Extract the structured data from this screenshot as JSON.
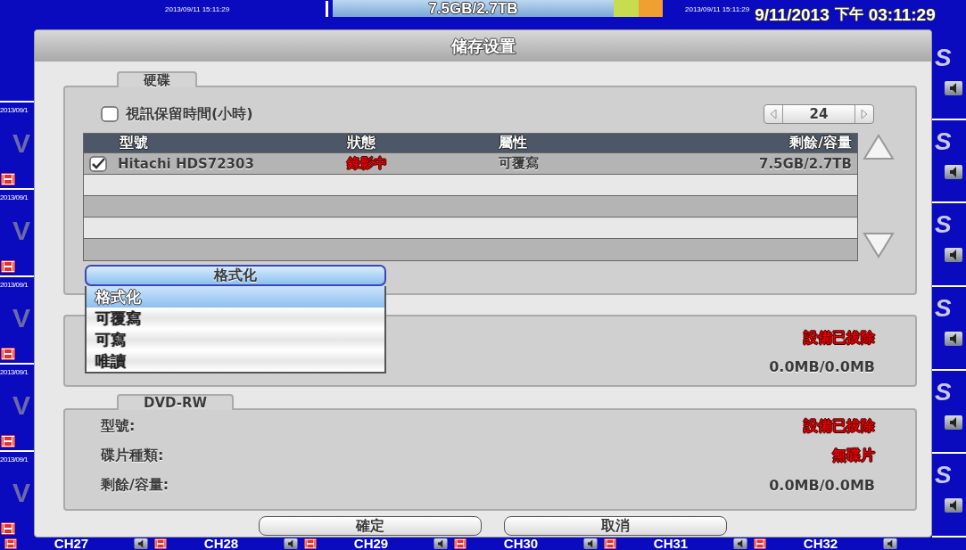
{
  "top_bar": {
    "cam_timestamp": "2013/09/11 15:11:29",
    "storage": "7.5GB/2.7TB",
    "clock_timestamp": "2013/09/11 15:11:29",
    "date": "9/11/2013",
    "period": "下午",
    "time": "03:11:29"
  },
  "left_tiles": [
    {
      "timestamp": "2013/09/1",
      "label": "V"
    },
    {
      "timestamp": "2013/09/1",
      "label": "V"
    },
    {
      "timestamp": "2013/09/1",
      "label": "V"
    },
    {
      "timestamp": "2013/09/1",
      "label": "V"
    },
    {
      "timestamp": "2013/09/1",
      "label": "V"
    }
  ],
  "right_tiles": [
    {
      "label": "S"
    },
    {
      "label": "S"
    },
    {
      "label": "S"
    },
    {
      "label": "S"
    },
    {
      "label": "S"
    },
    {
      "label": "S"
    }
  ],
  "bottom_bar": {
    "channels": [
      "CH27",
      "CH28",
      "CH29",
      "CH30",
      "CH31",
      "CH32"
    ]
  },
  "dialog": {
    "title": "储存设置",
    "hdd": {
      "legend": "硬碟",
      "retention": {
        "label": "視訊保留時間(小時)",
        "checked": false,
        "value": "24"
      },
      "columns": [
        "型號",
        "狀態",
        "屬性",
        "剩餘/容量"
      ],
      "rows": [
        {
          "checked": true,
          "model": "Hitachi HDS72303",
          "status": "錄影中",
          "attribute": "可覆寫",
          "capacity": "7.5GB/2.7TB"
        }
      ],
      "format_button": "格式化",
      "dropdown": [
        {
          "label": "格式化",
          "selected": true
        },
        {
          "label": "可覆寫",
          "selected": false
        },
        {
          "label": "可寫",
          "selected": false
        },
        {
          "label": "唯讀",
          "selected": false
        }
      ]
    },
    "usb": {
      "status": "設備已拔除",
      "capacity": "0.0MB/0.0MB"
    },
    "dvd": {
      "legend": "DVD-RW",
      "fields": [
        {
          "label": "型號:",
          "value": "設備已拔除",
          "kind": "alert"
        },
        {
          "label": "碟片種類:",
          "value": "無碟片",
          "kind": "alert"
        },
        {
          "label": "剩餘/容量:",
          "value": "0.0MB/0.0MB",
          "kind": "normal"
        }
      ]
    },
    "buttons": [
      "確定",
      "取消"
    ]
  }
}
